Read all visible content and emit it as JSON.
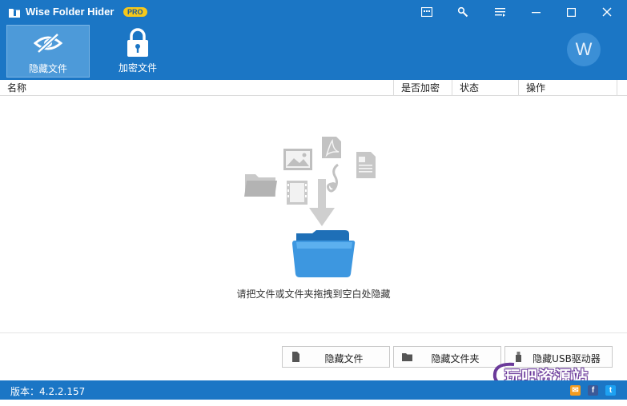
{
  "window": {
    "title": "Wise Folder Hider",
    "badge": "PRO",
    "controls": [
      "feedback-icon",
      "tools-icon",
      "menu-icon",
      "minimize-icon",
      "maximize-icon",
      "close-icon"
    ]
  },
  "toolbar": {
    "items": [
      {
        "label": "隐藏文件",
        "icon": "eye-slash-icon",
        "active": true
      },
      {
        "label": "加密文件",
        "icon": "lock-icon",
        "active": false
      }
    ],
    "avatar_letter": "W"
  },
  "table": {
    "columns": [
      "名称",
      "是否加密",
      "状态",
      "操作"
    ],
    "rows": []
  },
  "empty_state": {
    "hint": "请把文件或文件夹拖拽到空白处隐藏",
    "icons": [
      "folder-icon",
      "image-icon",
      "pdf-icon",
      "word-doc-icon",
      "music-icon",
      "film-icon",
      "down-arrow-icon",
      "blue-folder-icon"
    ]
  },
  "actions": {
    "hide_file": "隐藏文件",
    "hide_folder": "隐藏文件夹",
    "hide_usb": "隐藏USB驱动器"
  },
  "watermark": "玩吧资源站",
  "status": {
    "version": "版本：4.2.2.157",
    "social": [
      "email-icon",
      "facebook-icon",
      "twitter-icon"
    ]
  },
  "colors": {
    "brand_blue": "#1b76c5",
    "active_tab": "#4d9ad9",
    "pro_badge": "#f6c81b"
  }
}
